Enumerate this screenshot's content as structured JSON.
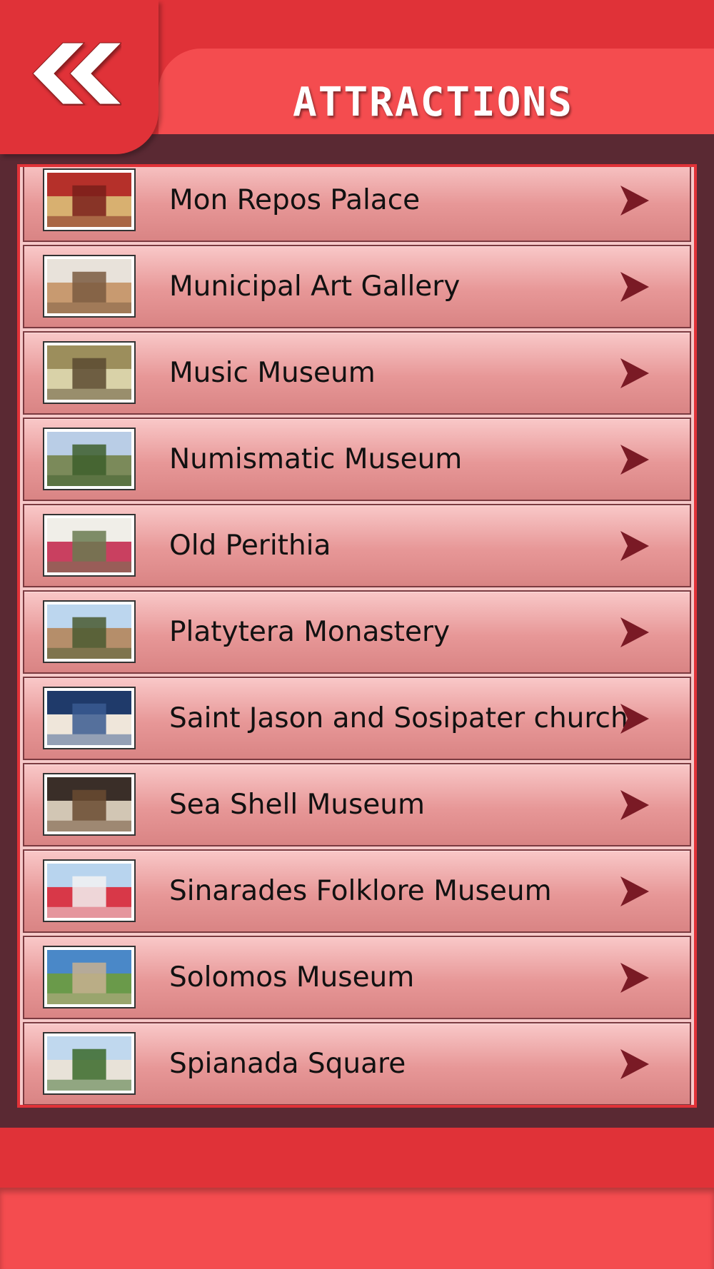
{
  "header": {
    "title": "ATTRACTIONS",
    "back_icon": "double-chevron-left-icon"
  },
  "colors": {
    "header_red": "#e03238",
    "band_red": "#f44c4f",
    "frame": "#5a2933",
    "arrow": "#7a1a25"
  },
  "list": {
    "items": [
      {
        "label": "Mon Repos Palace",
        "thumb": [
          "#b5302a",
          "#d8b070",
          "#7a1e1a"
        ]
      },
      {
        "label": "Municipal Art Gallery",
        "thumb": [
          "#e8e2da",
          "#c89a70",
          "#7a5a40"
        ]
      },
      {
        "label": "Music Museum",
        "thumb": [
          "#9c8e5c",
          "#d9d2a8",
          "#5a4a30"
        ]
      },
      {
        "label": "Numismatic Museum",
        "thumb": [
          "#b9cde6",
          "#7b8a5a",
          "#3d5e2c"
        ]
      },
      {
        "label": "Old Perithia",
        "thumb": [
          "#f0eee8",
          "#c94060",
          "#6a7a50"
        ]
      },
      {
        "label": "Platytera Monastery",
        "thumb": [
          "#bcd6ee",
          "#b58e6a",
          "#4a5a30"
        ]
      },
      {
        "label": "Saint Jason and Sosipater church",
        "thumb": [
          "#1f3a6a",
          "#efe6da",
          "#3a5a90"
        ]
      },
      {
        "label": "Sea Shell Museum",
        "thumb": [
          "#3a2e28",
          "#d2c6b4",
          "#6a4a30"
        ]
      },
      {
        "label": "Sinarades Folklore Museum",
        "thumb": [
          "#b8d4ee",
          "#d83848",
          "#f2f2f2"
        ]
      },
      {
        "label": "Solomos Museum",
        "thumb": [
          "#4a88c8",
          "#6a9a4a",
          "#c8b090"
        ]
      },
      {
        "label": "Spianada Square",
        "thumb": [
          "#c0d8ee",
          "#e8e2d8",
          "#3a6a2a"
        ]
      }
    ]
  }
}
